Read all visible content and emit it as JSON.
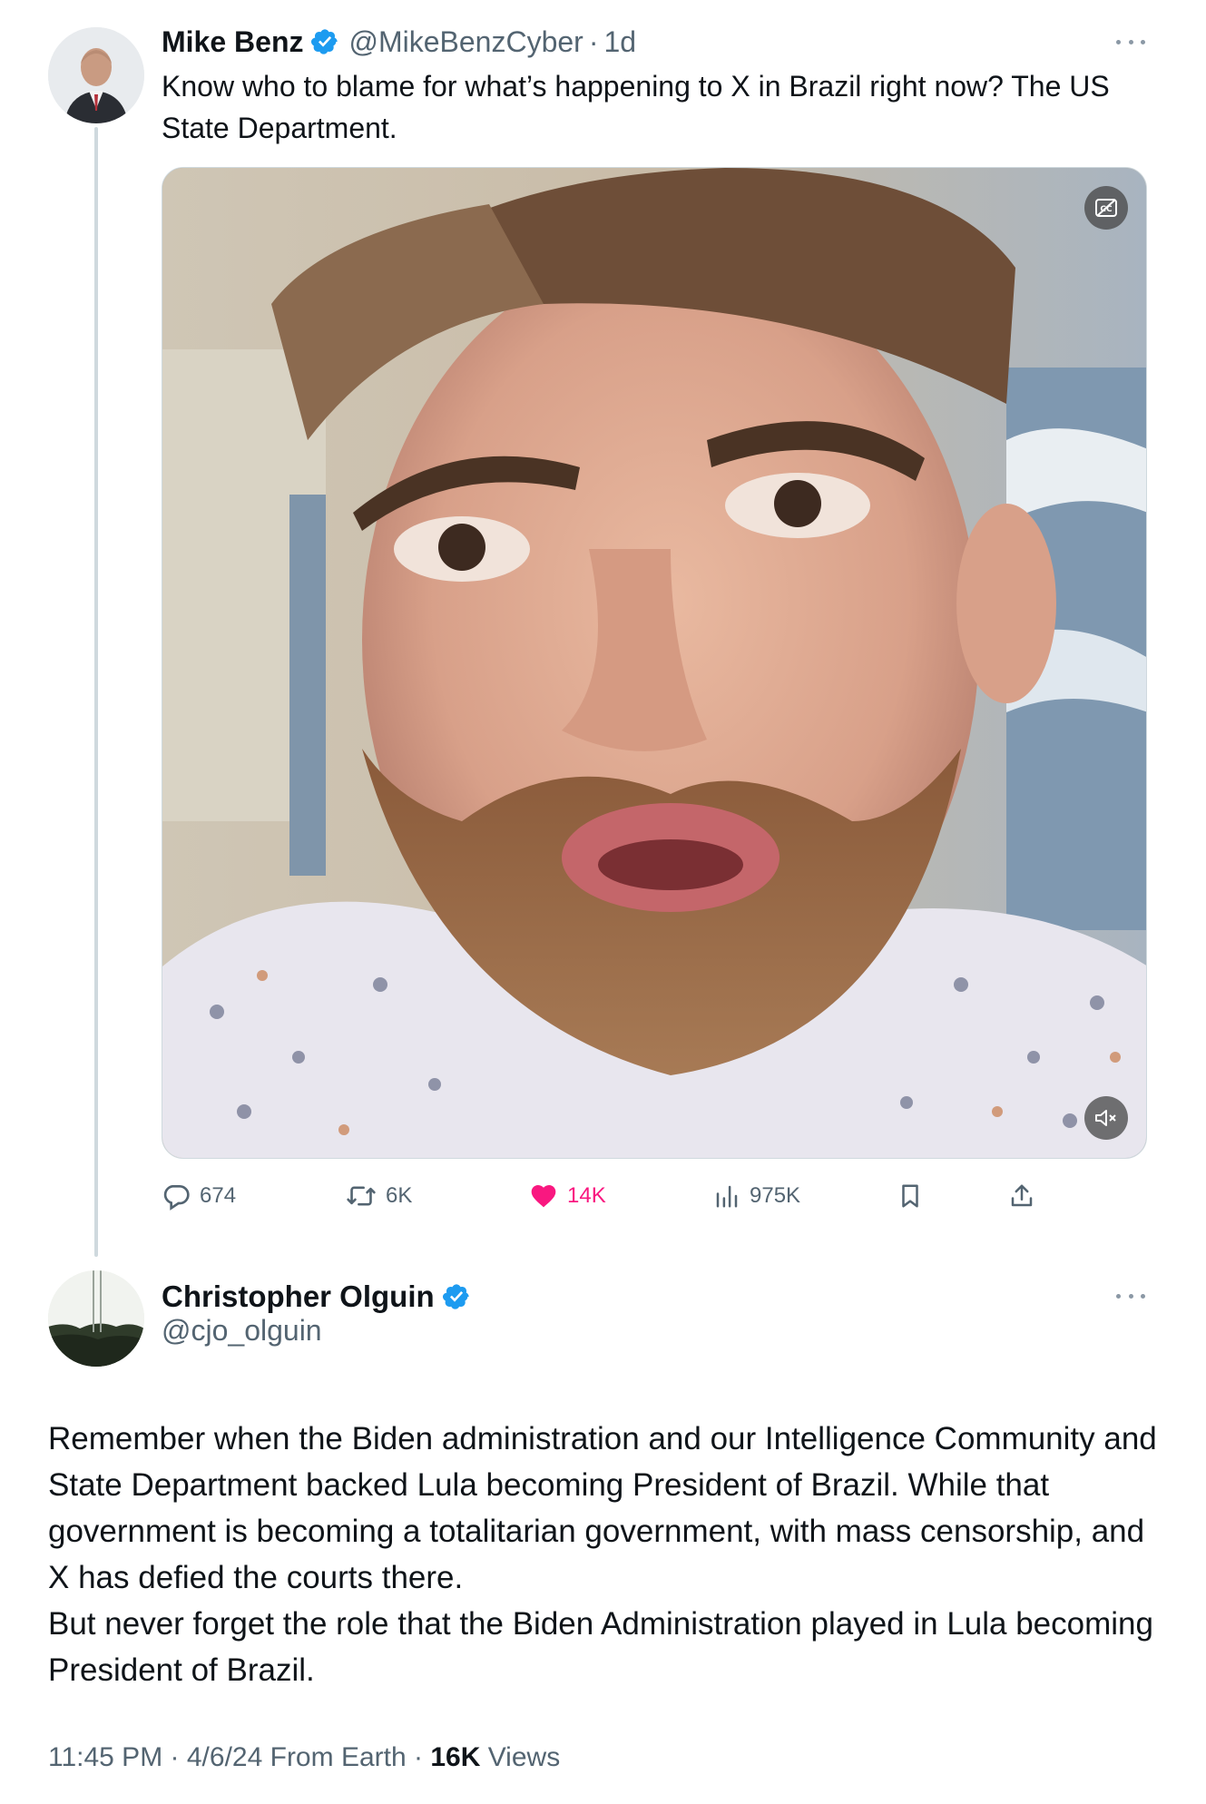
{
  "tweet1": {
    "author_name": "Mike Benz",
    "handle": "@MikeBenzCyber",
    "separator": "·",
    "time": "1d",
    "text": "Know who to blame for what’s happening to X in Brazil right now? The US State Department.",
    "actions": {
      "replies": "674",
      "retweets": "6K",
      "likes": "14K",
      "views": "975K"
    },
    "icons": [
      "verified-badge-icon",
      "more-options-icon",
      "captions-icon",
      "mute-icon",
      "reply-icon",
      "retweet-icon",
      "heart-icon",
      "views-icon",
      "bookmark-icon",
      "share-icon"
    ]
  },
  "tweet2": {
    "author_name": "Christopher Olguin",
    "handle": "@cjo_olguin",
    "text_paragraphs": [
      "Remember when the Biden administration and our Intelligence Community and State Department backed Lula becoming President of Brazil. While that government is becoming a totalitarian government, with mass censorship, and X has defied the courts there.",
      "But never forget the role that the Biden Administration played in Lula becoming President of Brazil."
    ],
    "meta": {
      "time": "11:45 PM",
      "sep1": " · ",
      "date": "4/6/24",
      "source": " From Earth",
      "sep2": " · ",
      "views_count": "16K",
      "views_label": " Views"
    }
  },
  "colors": {
    "verified": "#1d9bf0",
    "like": "#f91880",
    "secondary_text": "#536471",
    "thread_line": "#cfd9de"
  }
}
